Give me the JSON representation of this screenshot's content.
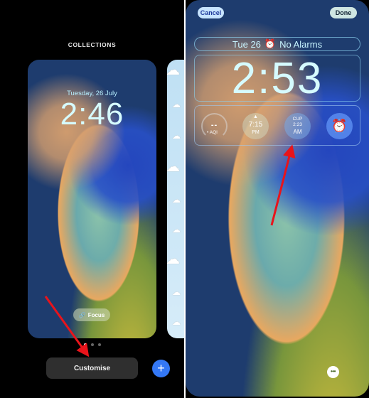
{
  "left_panel": {
    "title": "COLLECTIONS",
    "wallpaper_card": {
      "date": "Tuesday, 26 July",
      "time": "2:46",
      "focus_label": "Focus",
      "focus_icon": "link-icon"
    },
    "page_dots": {
      "count": 3,
      "active_index": 0
    },
    "customise_label": "Customise",
    "add_label": "+"
  },
  "right_panel": {
    "cancel_label": "Cancel",
    "done_label": "Done",
    "date_widget": {
      "date": "Tue 26",
      "alarm_icon": "alarm-clock-icon",
      "alarm_text": "No Alarms"
    },
    "time": "2:53",
    "widgets": {
      "aqi": {
        "value": "--",
        "label": "AQI"
      },
      "sunset": {
        "icon": "sunset-icon",
        "time": "7:15",
        "ampm": "PM"
      },
      "city_clock": {
        "city": "CUP",
        "time": "2:23",
        "ampm": "AM"
      },
      "alarm": {
        "icon": "alarm-clock-icon"
      }
    },
    "more_label": "•••"
  },
  "annotations": {
    "arrow_color": "#e8141b"
  }
}
